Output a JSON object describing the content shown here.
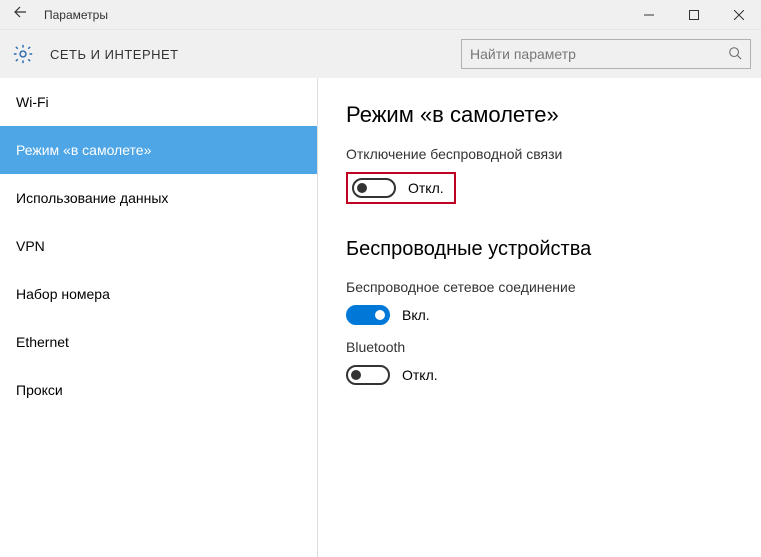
{
  "titlebar": {
    "title": "Параметры"
  },
  "header": {
    "section": "СЕТЬ И ИНТЕРНЕТ",
    "search_placeholder": "Найти параметр"
  },
  "sidebar": {
    "items": [
      {
        "label": "Wi-Fi"
      },
      {
        "label": "Режим «в самолете»"
      },
      {
        "label": "Использование данных"
      },
      {
        "label": "VPN"
      },
      {
        "label": "Набор номера"
      },
      {
        "label": "Ethernet"
      },
      {
        "label": "Прокси"
      }
    ]
  },
  "main": {
    "heading1": "Режим «в самолете»",
    "airplane_desc": "Отключение беспроводной связи",
    "airplane_toggle": "Откл.",
    "heading2": "Беспроводные устройства",
    "wifi_label": "Беспроводное сетевое соединение",
    "wifi_toggle": "Вкл.",
    "bt_label": "Bluetooth",
    "bt_toggle": "Откл."
  }
}
